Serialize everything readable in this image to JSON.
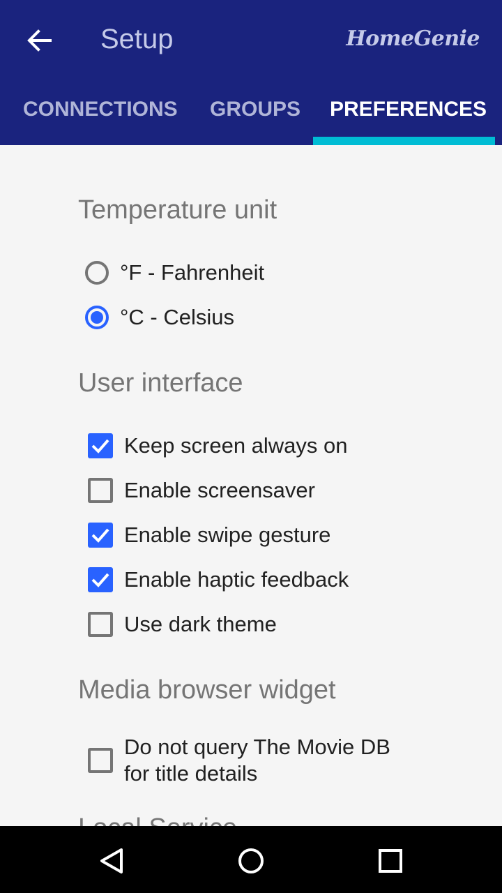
{
  "header": {
    "title": "Setup",
    "brand": "HomeGenie"
  },
  "tabs": [
    {
      "label": "CONNECTIONS",
      "active": false
    },
    {
      "label": "GROUPS",
      "active": false
    },
    {
      "label": "PREFERENCES",
      "active": true
    }
  ],
  "sections": {
    "temperature": {
      "title": "Temperature unit",
      "options": [
        {
          "label": "°F - Fahrenheit",
          "selected": false
        },
        {
          "label": "°C - Celsius",
          "selected": true
        }
      ]
    },
    "ui": {
      "title": "User interface",
      "options": [
        {
          "label": "Keep screen always on",
          "checked": true
        },
        {
          "label": "Enable screensaver",
          "checked": false
        },
        {
          "label": "Enable swipe gesture",
          "checked": true
        },
        {
          "label": "Enable haptic feedback",
          "checked": true
        },
        {
          "label": "Use dark theme",
          "checked": false
        }
      ]
    },
    "media": {
      "title": "Media browser widget",
      "option_line1": "Do not query The Movie DB",
      "option_line2": "for title details",
      "checked": false
    },
    "local": {
      "title": "Local Service"
    }
  },
  "colors": {
    "appbar": "#1a237e",
    "accent": "#2962ff",
    "tab_indicator": "#00bcd4"
  },
  "icons": {
    "back": "arrow-back-icon",
    "nav_back": "triangle-back-icon",
    "nav_home": "circle-home-icon",
    "nav_recents": "square-recents-icon"
  }
}
